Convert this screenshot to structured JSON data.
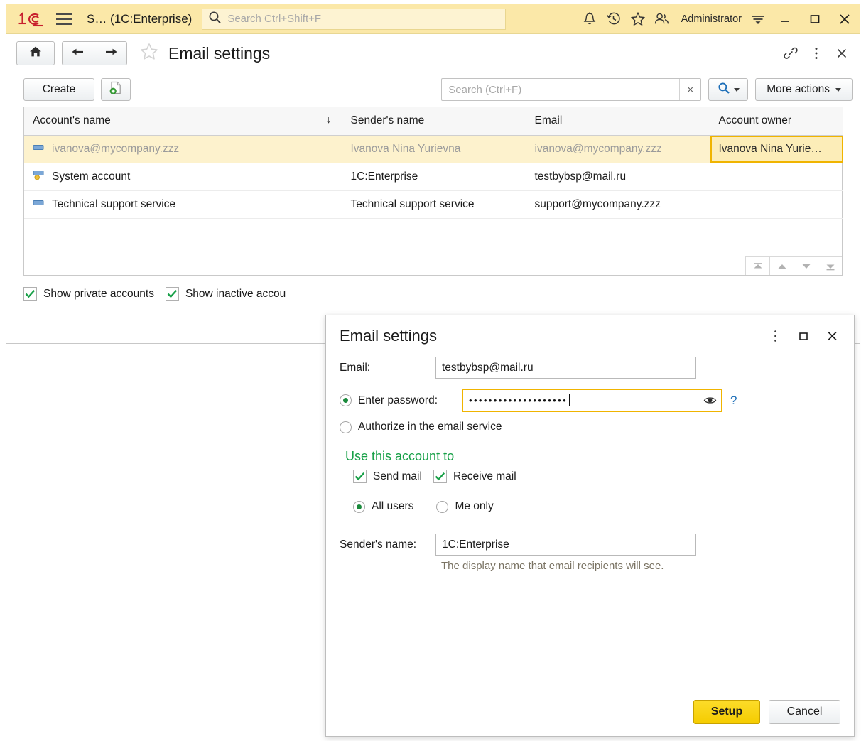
{
  "titlebar": {
    "logo": "1C-logo-icon",
    "menu_icon": "hamburger-menu-icon",
    "app_title": "S… (1C:Enterprise)",
    "search_placeholder": "Search Ctrl+Shift+F",
    "search_icon": "search-icon",
    "icons": [
      "bell-icon",
      "history-clock-icon",
      "star-icon",
      "users-icon"
    ],
    "user": "Administrator",
    "options_icon": "options-menu-icon",
    "minimize": "—",
    "maximize": "□",
    "close": "✕",
    "bg_color": "#fbe8a8"
  },
  "nav": {
    "home_icon": "home-icon",
    "back_icon": "arrow-left-icon",
    "forward_icon": "arrow-right-icon",
    "favorite_icon": "star-outline-icon",
    "page_title": "Email settings",
    "link_icon": "link-icon",
    "kebab_icon": "more-vertical-icon",
    "close_icon": "close-icon"
  },
  "commandbar": {
    "create_label": "Create",
    "create_copy_icon": "new-document-icon",
    "search_placeholder": "Search (Ctrl+F)",
    "search_value": "",
    "clear_label": "×",
    "find_icon": "magnifier-icon",
    "more_actions_label": "More actions"
  },
  "table": {
    "columns": [
      {
        "label": "Account's name",
        "sort": "↓"
      },
      {
        "label": "Sender's name",
        "sort": ""
      },
      {
        "label": "Email",
        "sort": ""
      },
      {
        "label": "Account owner",
        "sort": ""
      }
    ],
    "rows": [
      {
        "icon": "account-inactive-icon",
        "account_name": "ivanova@mycompany.zzz",
        "sender_name": "Ivanova Nina Yurievna",
        "email": "ivanova@mycompany.zzz",
        "owner": "Ivanova Nina Yurie…",
        "selected": true,
        "focus_cell": "owner"
      },
      {
        "icon": "account-system-icon",
        "account_name": "System account",
        "sender_name": "1C:Enterprise",
        "email": "testbybsp@mail.ru",
        "owner": "",
        "selected": false,
        "focus_cell": ""
      },
      {
        "icon": "account-inactive-icon",
        "account_name": "Technical support service",
        "sender_name": "Technical support service",
        "email": "support@mycompany.zzz",
        "owner": "",
        "selected": false,
        "focus_cell": ""
      }
    ],
    "nav_buttons": [
      "first-row-icon",
      "prev-row-icon",
      "next-row-icon",
      "last-row-icon"
    ]
  },
  "footer": {
    "checkboxes": [
      {
        "label": "Show private accounts",
        "checked": true
      },
      {
        "label": "Show inactive accou",
        "checked": true
      }
    ]
  },
  "dialog": {
    "title": "Email settings",
    "kebab_icon": "more-vertical-icon",
    "maximize_icon": "maximize-icon",
    "close_icon": "close-icon",
    "email_label": "Email:",
    "email_value": "testbybsp@mail.ru",
    "password_radio_label": "Enter password:",
    "password_radio_selected": true,
    "password_value": "••••••••••••••••••••",
    "eye_icon": "eye-icon",
    "help_label": "?",
    "authorize_radio_label": "Authorize in the email service",
    "authorize_radio_selected": false,
    "use_account_header": "Use this account to",
    "use_account_header_color": "#17a047",
    "send_mail": {
      "label": "Send mail",
      "checked": true
    },
    "receive_mail": {
      "label": "Receive mail",
      "checked": true
    },
    "scope_all_users": {
      "label": "All users",
      "selected": true
    },
    "scope_me_only": {
      "label": "Me only",
      "selected": false
    },
    "sender_label": "Sender's name:",
    "sender_value": "1C:Enterprise",
    "sender_hint": "The display name that email recipients will see.",
    "setup_label": "Setup",
    "cancel_label": "Cancel",
    "setup_color": "#f5cc00"
  }
}
